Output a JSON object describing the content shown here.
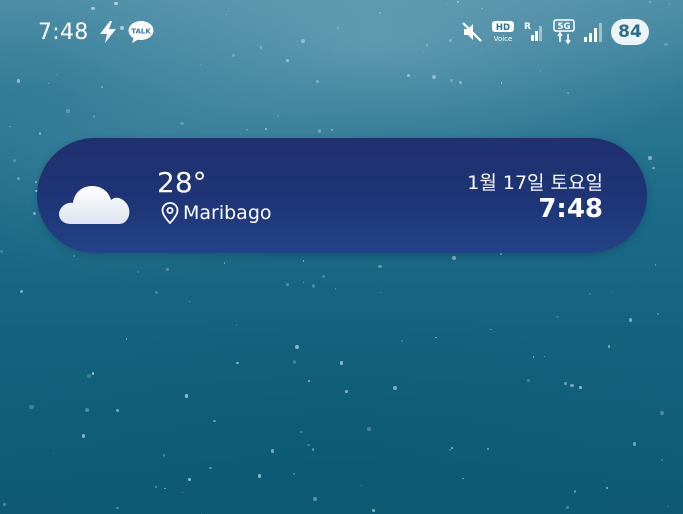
{
  "status_bar": {
    "time": "7:48",
    "left_icons": [
      "flash-icon",
      "kakaotalk-icon"
    ],
    "kakaotalk_label": "TALK",
    "right_icons": [
      "mute-icon",
      "hd-voice-icon",
      "signal-r-icon",
      "5g-icon",
      "signal-icon"
    ],
    "hd_label": "HD",
    "voice_label": "Voice",
    "roaming_label": "R",
    "network_label": "5G",
    "battery_level": "84"
  },
  "weather_widget": {
    "icon": "partly-cloudy-night-icon",
    "temperature": "28°",
    "location": "Maribago",
    "date": "1월 17일 토요일",
    "time": "7:48",
    "background": "#20306f"
  }
}
